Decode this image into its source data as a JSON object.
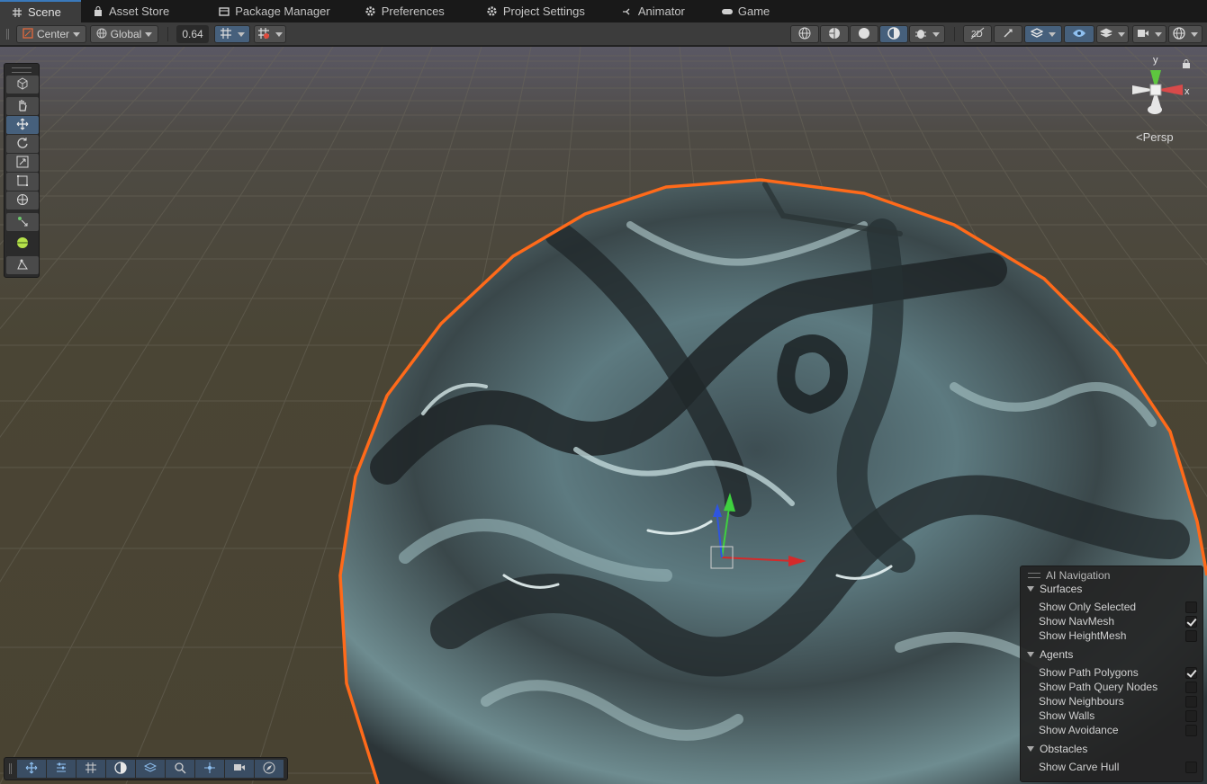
{
  "tabs": [
    {
      "label": "Scene",
      "icon": "grid-icon",
      "active": true
    },
    {
      "label": "Asset Store",
      "icon": "store-bag-icon"
    },
    {
      "label": "Package Manager",
      "icon": "package-icon"
    },
    {
      "label": "Preferences",
      "icon": "gear-icon"
    },
    {
      "label": "Project Settings",
      "icon": "gear-icon"
    },
    {
      "label": "Animator",
      "icon": "animator-icon"
    },
    {
      "label": "Game",
      "icon": "gamepad-icon"
    }
  ],
  "toolbar": {
    "pivot_mode": "Center",
    "pivot_rotation": "Global",
    "grid_snap_value": "0.64"
  },
  "scene": {
    "projection_label": "Persp",
    "gizmo_axes": [
      "y",
      "x"
    ],
    "colors": {
      "ground": "#4a4535",
      "sphere_outline": "#ff6a1a",
      "axis_x": "#d42a2a",
      "axis_y": "#3fd13f",
      "axis_z": "#2f55e0",
      "selected_button": "#46607c"
    }
  },
  "ai_navigation": {
    "title": "AI Navigation",
    "sections": [
      {
        "label": "Surfaces",
        "options": [
          {
            "label": "Show Only Selected",
            "checked": false
          },
          {
            "label": "Show NavMesh",
            "checked": true
          },
          {
            "label": "Show HeightMesh",
            "checked": false
          }
        ]
      },
      {
        "label": "Agents",
        "options": [
          {
            "label": "Show Path Polygons",
            "checked": true
          },
          {
            "label": "Show Path Query Nodes",
            "checked": false
          },
          {
            "label": "Show Neighbours",
            "checked": false
          },
          {
            "label": "Show Walls",
            "checked": false
          },
          {
            "label": "Show Avoidance",
            "checked": false
          }
        ]
      },
      {
        "label": "Obstacles",
        "options": [
          {
            "label": "Show Carve Hull",
            "checked": false
          }
        ]
      }
    ]
  }
}
